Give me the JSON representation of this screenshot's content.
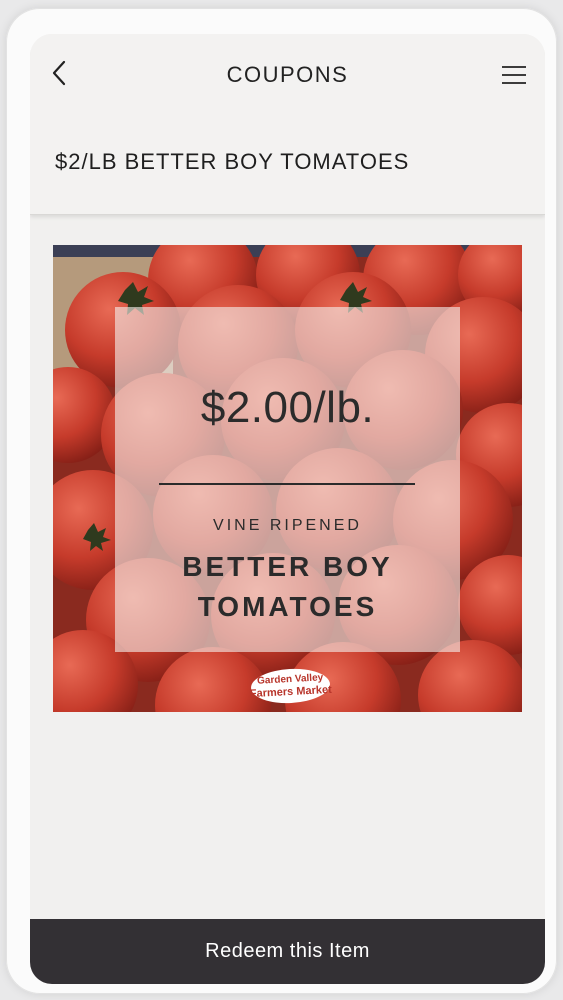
{
  "header": {
    "title": "COUPONS",
    "back_icon": "chevron-left-icon",
    "menu_icon": "hamburger-menu-icon"
  },
  "coupon": {
    "title": "$2/LB BETTER BOY TOMATOES",
    "image": {
      "price": "$2.00/lb.",
      "subtitle": "VINE RIPENED",
      "product_line1": "BETTER BOY",
      "product_line2": "TOMATOES",
      "logo_line1": "Garden Valley",
      "logo_line2": "Farmers Market"
    }
  },
  "redeem": {
    "label": "Redeem this Item"
  },
  "colors": {
    "button_bg": "#333034",
    "tomato_red": "#c23a2a",
    "logo_red": "#b8352b"
  }
}
